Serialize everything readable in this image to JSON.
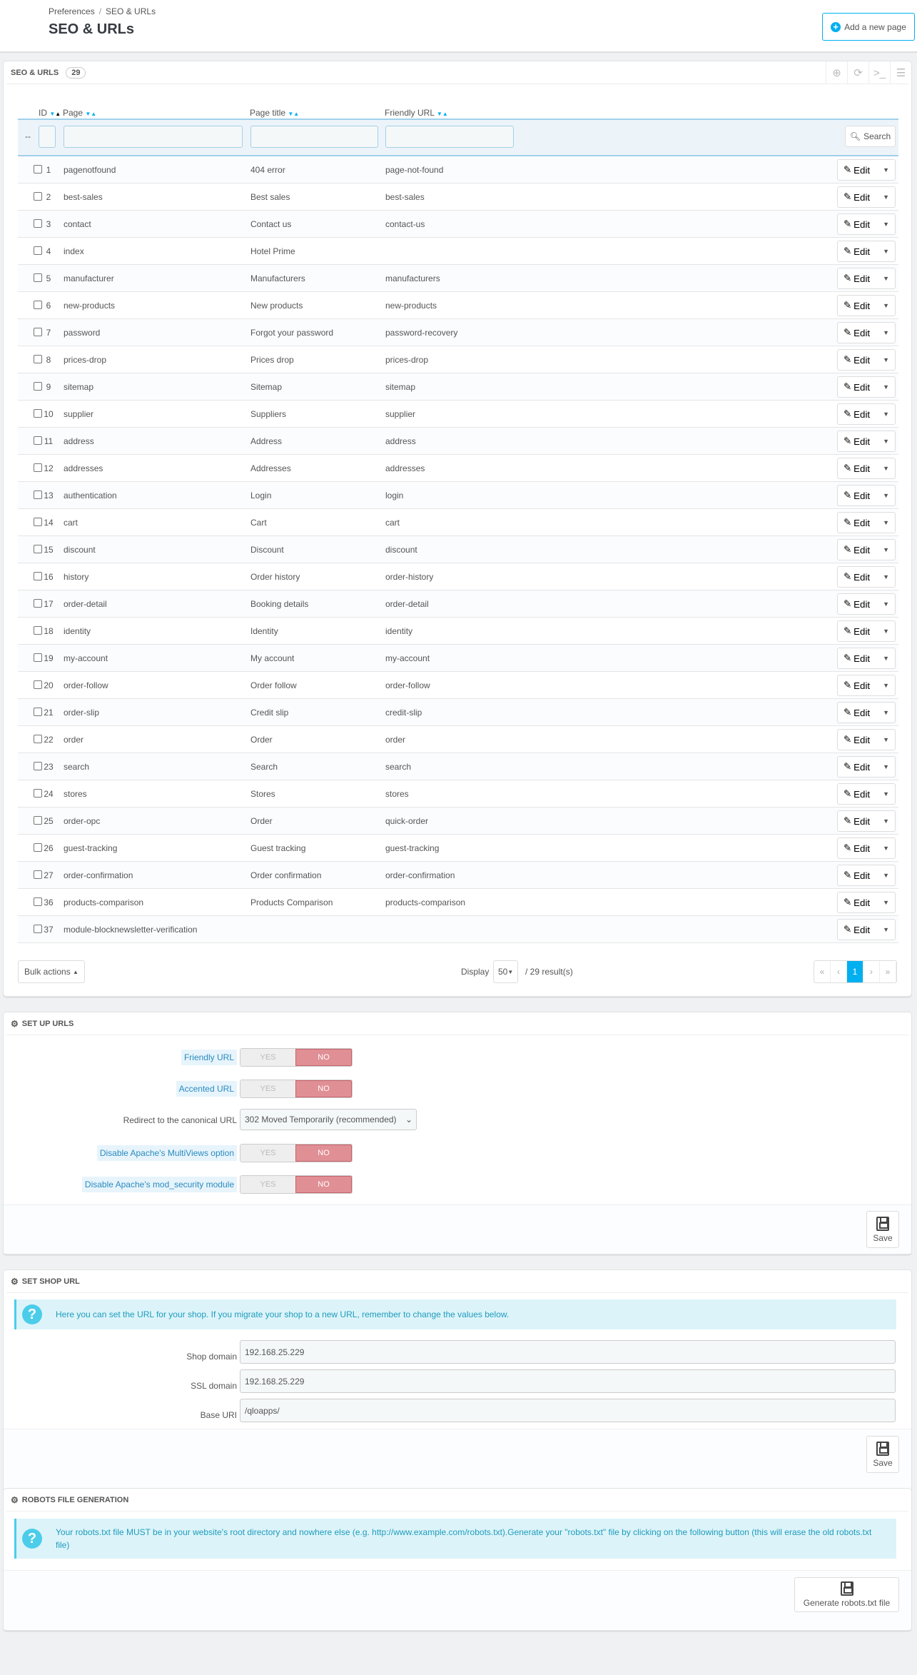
{
  "header": {
    "breadcrumb": [
      "Preferences",
      "SEO & URLs"
    ],
    "title": "SEO & URLs",
    "add_button": "Add a new page"
  },
  "list": {
    "title": "SEO & URLs",
    "count": "29",
    "columns": {
      "id": "ID",
      "page": "Page",
      "page_title": "Page title",
      "friendly_url": "Friendly URL"
    },
    "filter_placeholder": "--",
    "search_label": "Search",
    "edit_label": "Edit",
    "rows": [
      [
        "1",
        "pagenotfound",
        "404 error",
        "page-not-found"
      ],
      [
        "2",
        "best-sales",
        "Best sales",
        "best-sales"
      ],
      [
        "3",
        "contact",
        "Contact us",
        "contact-us"
      ],
      [
        "4",
        "index",
        "Hotel Prime",
        ""
      ],
      [
        "5",
        "manufacturer",
        "Manufacturers",
        "manufacturers"
      ],
      [
        "6",
        "new-products",
        "New products",
        "new-products"
      ],
      [
        "7",
        "password",
        "Forgot your password",
        "password-recovery"
      ],
      [
        "8",
        "prices-drop",
        "Prices drop",
        "prices-drop"
      ],
      [
        "9",
        "sitemap",
        "Sitemap",
        "sitemap"
      ],
      [
        "10",
        "supplier",
        "Suppliers",
        "supplier"
      ],
      [
        "11",
        "address",
        "Address",
        "address"
      ],
      [
        "12",
        "addresses",
        "Addresses",
        "addresses"
      ],
      [
        "13",
        "authentication",
        "Login",
        "login"
      ],
      [
        "14",
        "cart",
        "Cart",
        "cart"
      ],
      [
        "15",
        "discount",
        "Discount",
        "discount"
      ],
      [
        "16",
        "history",
        "Order history",
        "order-history"
      ],
      [
        "17",
        "order-detail",
        "Booking details",
        "order-detail"
      ],
      [
        "18",
        "identity",
        "Identity",
        "identity"
      ],
      [
        "19",
        "my-account",
        "My account",
        "my-account"
      ],
      [
        "20",
        "order-follow",
        "Order follow",
        "order-follow"
      ],
      [
        "21",
        "order-slip",
        "Credit slip",
        "credit-slip"
      ],
      [
        "22",
        "order",
        "Order",
        "order"
      ],
      [
        "23",
        "search",
        "Search",
        "search"
      ],
      [
        "24",
        "stores",
        "Stores",
        "stores"
      ],
      [
        "25",
        "order-opc",
        "Order",
        "quick-order"
      ],
      [
        "26",
        "guest-tracking",
        "Guest tracking",
        "guest-tracking"
      ],
      [
        "27",
        "order-confirmation",
        "Order confirmation",
        "order-confirmation"
      ],
      [
        "36",
        "products-comparison",
        "Products Comparison",
        "products-comparison"
      ],
      [
        "37",
        "module-blocknewsletter-verification",
        "",
        ""
      ]
    ],
    "bulk_actions": "Bulk actions",
    "display_label": "Display",
    "per_page": "50",
    "results": "/ 29 result(s)",
    "current_page": "1"
  },
  "setup_urls": {
    "title": "SET UP URLS",
    "yes": "YES",
    "no": "NO",
    "friendly_url": {
      "label": "Friendly URL",
      "value": "NO"
    },
    "accented_url": {
      "label": "Accented URL",
      "value": "NO"
    },
    "redirect": {
      "label": "Redirect to the canonical URL",
      "value": "302 Moved Temporarily (recommended)"
    },
    "multiviews": {
      "label": "Disable Apache's MultiViews option",
      "value": "NO"
    },
    "mod_security": {
      "label": "Disable Apache's mod_security module",
      "value": "NO"
    },
    "save": "Save"
  },
  "shop_url": {
    "title": "SET SHOP URL",
    "info": "Here you can set the URL for your shop. If you migrate your shop to a new URL, remember to change the values below.",
    "shop_domain_label": "Shop domain",
    "shop_domain": "192.168.25.229",
    "ssl_domain_label": "SSL domain",
    "ssl_domain": "192.168.25.229",
    "base_uri_label": "Base URI",
    "base_uri": "/qloapps/",
    "save": "Save"
  },
  "robots": {
    "title": "ROBOTS FILE GENERATION",
    "info": "Your robots.txt file MUST be in your website's root directory and nowhere else (e.g. http://www.example.com/robots.txt).Generate your \"robots.txt\" file by clicking on the following button (this will erase the old robots.txt file)",
    "button": "Generate robots.txt file"
  },
  "colors": {
    "accent": "#00aff0",
    "no_active": "#e08f95",
    "info_bg": "#dcf4f9"
  }
}
